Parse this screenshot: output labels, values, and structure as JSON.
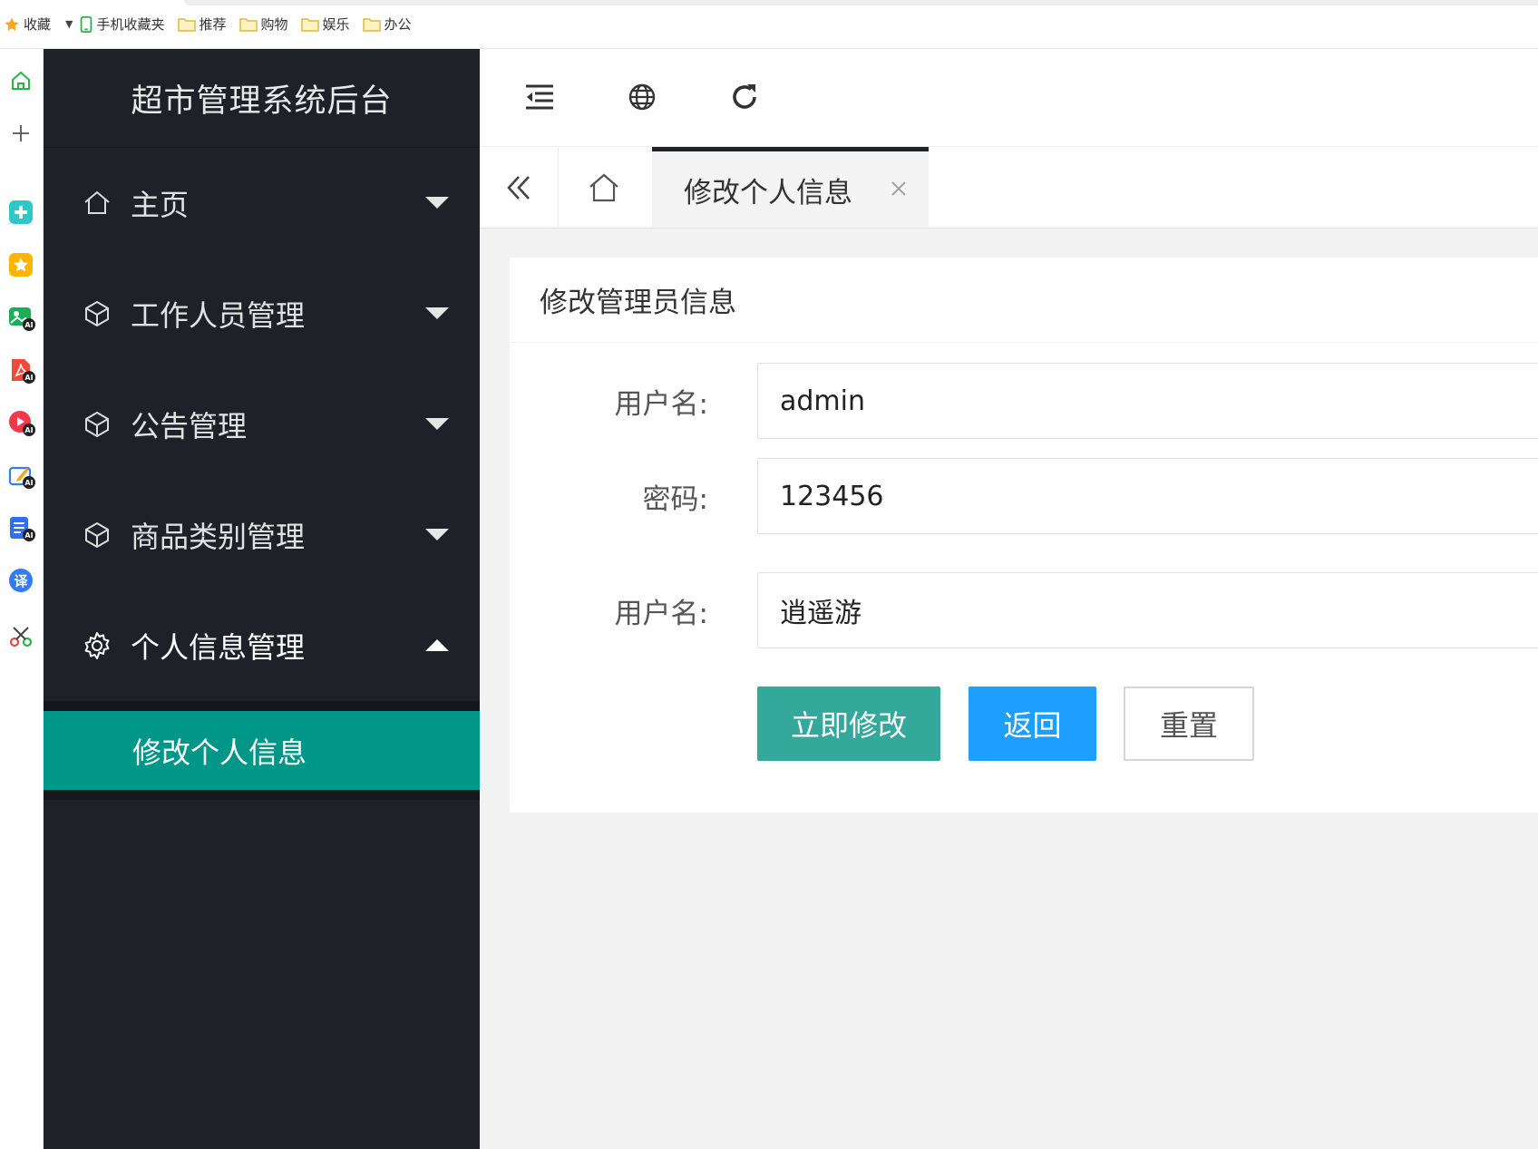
{
  "browser": {
    "bookmarks": [
      {
        "label": "收藏",
        "icon": "star-icon"
      },
      {
        "label": "手机收藏夹",
        "icon": "phone-icon"
      },
      {
        "label": "推荐",
        "icon": "folder-icon"
      },
      {
        "label": "购物",
        "icon": "folder-icon"
      },
      {
        "label": "娱乐",
        "icon": "folder-icon"
      },
      {
        "label": "办公",
        "icon": "folder-icon"
      }
    ],
    "caret": "▼",
    "rail_ai_badge": "AI",
    "rail_translate": "译"
  },
  "sidebar": {
    "logo": "超市管理系统后台",
    "menu": [
      {
        "label": "主页",
        "icon": "home-icon",
        "open": false
      },
      {
        "label": "工作人员管理",
        "icon": "cube-icon",
        "open": false
      },
      {
        "label": "公告管理",
        "icon": "cube-icon",
        "open": false
      },
      {
        "label": "商品类别管理",
        "icon": "cube-icon",
        "open": false
      },
      {
        "label": "个人信息管理",
        "icon": "gear-icon",
        "open": true
      }
    ],
    "submenu": {
      "active": "修改个人信息"
    }
  },
  "tabs": {
    "active_label": "修改个人信息"
  },
  "form": {
    "title": "修改管理员信息",
    "fields": {
      "username_label": "用户名:",
      "username_value": "admin",
      "password_label": "密码:",
      "password_value": "123456",
      "nickname_label": "用户名:",
      "nickname_value": "逍遥游"
    },
    "buttons": {
      "submit": "立即修改",
      "back": "返回",
      "reset": "重置"
    }
  },
  "colors": {
    "sidebar_bg": "#1f2128",
    "active_teal": "#009688",
    "submit_teal": "#35a89c",
    "blue": "#1e9fff",
    "content_bg": "#f2f2f2"
  }
}
